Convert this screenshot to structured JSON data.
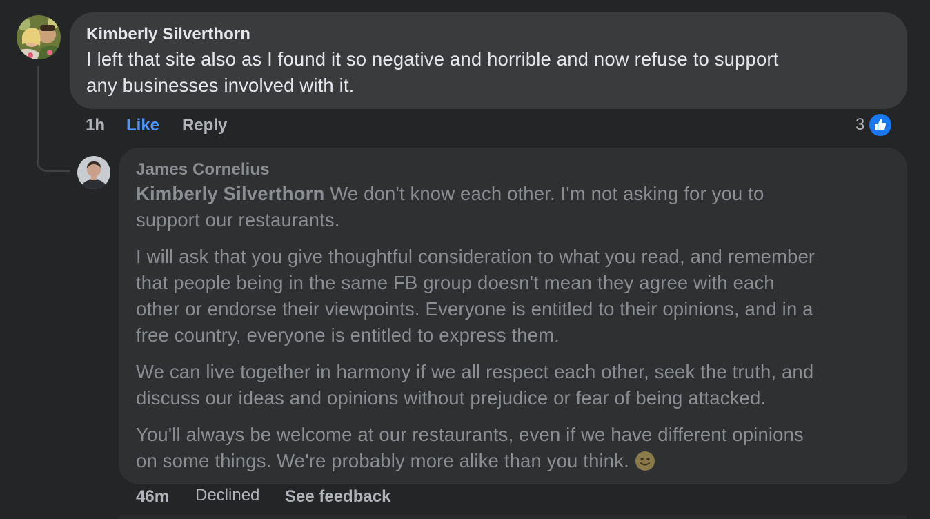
{
  "top_cut_text": "Like  Reply",
  "comments": [
    {
      "author": "Kimberly Silverthorn",
      "lines": [
        "I left that site also as I found it so negative and horrible and now refuse to support",
        "any businesses involved with it."
      ],
      "time": "1h",
      "like_label": "Like",
      "reply_label": "Reply",
      "reaction_count": "3",
      "reaction_icon": "thumbs-up-icon"
    },
    {
      "author": "James Cornelius",
      "mention": "Kimberly Silverthorn",
      "p1_first": " We don't know each other. I'm not asking for you to",
      "p1_second": "support our restaurants.",
      "p2": [
        "I will ask that you give thoughtful consideration to what you read, and remember",
        "that people being in the same FB group doesn't mean they agree with each",
        "other or endorse their viewpoints. Everyone is entitled to their opinions, and in a",
        "free country, everyone is entitled to express them."
      ],
      "p3": [
        "We can live together in harmony if we all respect each other, seek the truth, and",
        "discuss our ideas and opinions without prejudice or fear of being attacked."
      ],
      "p4": [
        "You'll always be welcome at our restaurants, even if we have different opinions",
        "on some things. We're probably more alike than you think."
      ],
      "emoji": "slightly-smiling-face-icon",
      "time": "46m",
      "status": "Declined",
      "feedback_label": "See feedback"
    }
  ],
  "colors": {
    "background": "#242526",
    "bubble": "#3a3b3c",
    "declined_bubble": "#2f3031",
    "like_blue": "#4f96ff",
    "reaction_blue": "#1877f2"
  }
}
